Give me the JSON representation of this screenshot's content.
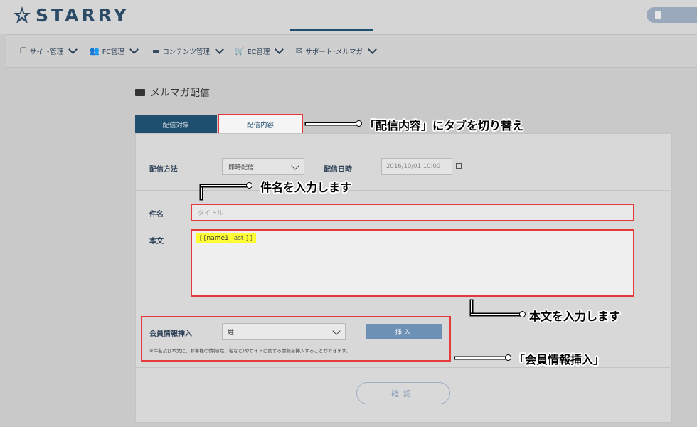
{
  "header": {
    "logo_text": "STARRY"
  },
  "nav": {
    "items": [
      {
        "label": "サイト管理",
        "icon": "copy-icon"
      },
      {
        "label": "FC管理",
        "icon": "users-icon"
      },
      {
        "label": "コンテンツ管理",
        "icon": "folder-icon"
      },
      {
        "label": "EC管理",
        "icon": "cart-icon"
      },
      {
        "label": "サポート･メルマガ",
        "icon": "envelope-icon"
      }
    ],
    "active_index": 4
  },
  "page": {
    "title": "メルマガ配信"
  },
  "tabs": {
    "target": "配信対象",
    "content": "配信内容"
  },
  "form": {
    "method_label": "配信方法",
    "method_value": "即時配信",
    "datetime_label": "配信日時",
    "datetime_value": "2016/10/01 10:00",
    "subject_label": "件名",
    "subject_placeholder": "タイトル",
    "body_label": "本文",
    "body_token_open": "{{ ",
    "body_token_var": "name1",
    "body_token_rest": "_last }}",
    "member_label": "会員情報挿入",
    "member_value": "姓",
    "insert_button": "挿入",
    "member_note": "※件名及び本文に、お客様の情報(姓、名など)やサイトに関する情報を挿入することができます。",
    "confirm_button": "確認"
  },
  "annotations": {
    "tab_switch": "「配信内容」にタブを切り替え",
    "subject": "件名を入力します",
    "body": "本文を入力します",
    "member": "「会員情報挿入」"
  },
  "colors": {
    "highlight_border": "#e53a3a",
    "active_tab": "#1f4f6e",
    "insert_button": "#6d90b5",
    "token_highlight": "#ffff33"
  }
}
